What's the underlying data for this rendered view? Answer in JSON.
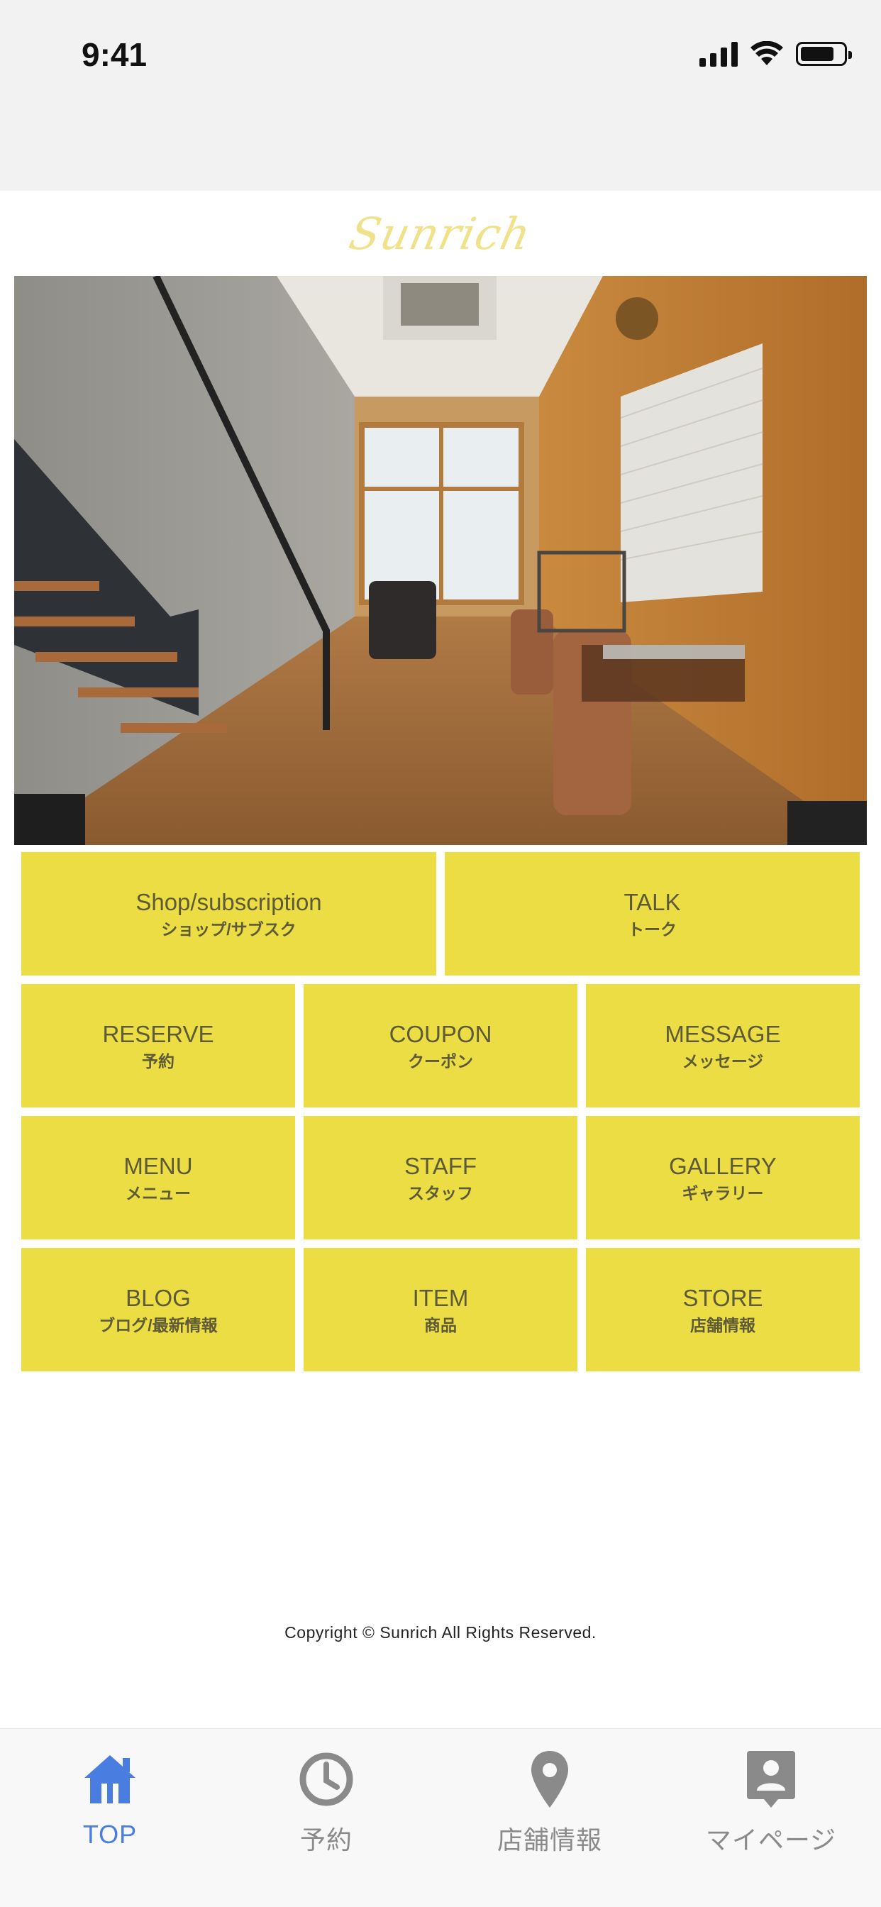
{
  "status_bar": {
    "time": "9:41"
  },
  "app": {
    "logo_text": "Sunrich"
  },
  "tiles": [
    {
      "en": "Shop/subscription",
      "jp": "ショップ/サブスク"
    },
    {
      "en": "TALK",
      "jp": "トーク"
    },
    {
      "en": "RESERVE",
      "jp": "予約"
    },
    {
      "en": "COUPON",
      "jp": "クーポン"
    },
    {
      "en": "MESSAGE",
      "jp": "メッセージ"
    },
    {
      "en": "MENU",
      "jp": "メニュー"
    },
    {
      "en": "STAFF",
      "jp": "スタッフ"
    },
    {
      "en": "GALLERY",
      "jp": "ギャラリー"
    },
    {
      "en": "BLOG",
      "jp": "ブログ/最新情報"
    },
    {
      "en": "ITEM",
      "jp": "商品"
    },
    {
      "en": "STORE",
      "jp": "店舗情報"
    }
  ],
  "footer": {
    "copyright": "Copyright © Sunrich All Rights Reserved."
  },
  "tabbar": {
    "items": [
      {
        "label": "TOP",
        "icon": "home-icon",
        "active": true
      },
      {
        "label": "予約",
        "icon": "clock-icon",
        "active": false
      },
      {
        "label": "店舗情報",
        "icon": "map-pin-icon",
        "active": false
      },
      {
        "label": "マイページ",
        "icon": "user-badge-icon",
        "active": false
      }
    ]
  },
  "colors": {
    "tile": "#ecdd44",
    "tile_text": "#5d5a38",
    "logo": "#efe28a",
    "tab_active": "#4a7de0",
    "tab_inactive": "#8a8a8a"
  }
}
